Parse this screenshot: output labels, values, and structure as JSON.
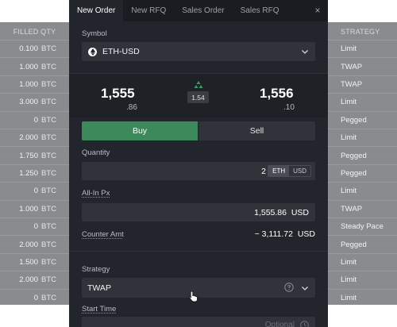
{
  "background_blotter": {
    "left_header": "FILLED QTY",
    "right_header": "STRATEGY",
    "rows": [
      {
        "qty": "0.100",
        "ccy": "BTC",
        "strategy": "Limit"
      },
      {
        "qty": "1.000",
        "ccy": "BTC",
        "strategy": "TWAP"
      },
      {
        "qty": "1.000",
        "ccy": "BTC",
        "strategy": "TWAP"
      },
      {
        "qty": "3.000",
        "ccy": "BTC",
        "strategy": "Limit"
      },
      {
        "qty": "0",
        "ccy": "BTC",
        "strategy": "Pegged"
      },
      {
        "qty": "2.000",
        "ccy": "BTC",
        "strategy": "Limit"
      },
      {
        "qty": "1.750",
        "ccy": "BTC",
        "strategy": "Pegged"
      },
      {
        "qty": "1.250",
        "ccy": "BTC",
        "strategy": "Pegged"
      },
      {
        "qty": "0",
        "ccy": "BTC",
        "strategy": "Limit"
      },
      {
        "qty": "1.000",
        "ccy": "BTC",
        "strategy": "TWAP"
      },
      {
        "qty": "0",
        "ccy": "BTC",
        "strategy": "Steady Pace"
      },
      {
        "qty": "2.000",
        "ccy": "BTC",
        "strategy": "Pegged"
      },
      {
        "qty": "1.500",
        "ccy": "BTC",
        "strategy": "Limit"
      },
      {
        "qty": "2.000",
        "ccy": "BTC",
        "strategy": "Limit"
      },
      {
        "qty": "0",
        "ccy": "BTC",
        "strategy": "Limit"
      }
    ]
  },
  "ticket": {
    "tabs": [
      {
        "label": "New Order",
        "active": true
      },
      {
        "label": "New RFQ",
        "active": false
      },
      {
        "label": "Sales Order",
        "active": false
      },
      {
        "label": "Sales RFQ",
        "active": false
      }
    ],
    "close_glyph": "×",
    "symbol": {
      "label": "Symbol",
      "value": "ETH-USD",
      "icon": "ethereum-icon"
    },
    "prices": {
      "bid_big": "1,555",
      "bid_small": ".86",
      "offer_big": "1,556",
      "offer_small": ".10",
      "spread": "1.54"
    },
    "side": {
      "buy_label": "Buy",
      "sell_label": "Sell",
      "selected": "Buy"
    },
    "quantity": {
      "label": "Quantity",
      "value": "2",
      "currencies": [
        "ETH",
        "USD"
      ],
      "selected_currency": "ETH"
    },
    "all_in_px": {
      "label": "All-In Px",
      "value": "1,555.86",
      "unit": "USD"
    },
    "counter_amt": {
      "label": "Counter Amt",
      "value": "~ 3,111.72",
      "unit": "USD"
    },
    "strategy": {
      "label": "Strategy",
      "value": "TWAP"
    },
    "start_time": {
      "label": "Start Time",
      "placeholder": "Optional"
    }
  },
  "colors": {
    "buy": "#3c8a5b",
    "panel": "#22252b",
    "field": "#30333a",
    "spread_icon": "#3c9c66",
    "overlay": "#8a8b8e"
  }
}
